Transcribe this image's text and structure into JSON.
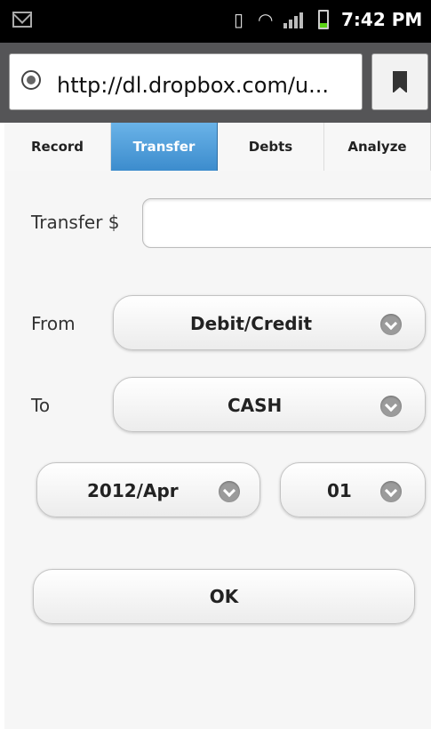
{
  "status_bar": {
    "time": "7:42 PM",
    "icons": [
      "mail-icon",
      "vibrate-icon",
      "wifi-icon",
      "signal-icon",
      "battery-icon"
    ]
  },
  "browser": {
    "url": "http://dl.dropbox.com/u..."
  },
  "tabs": [
    {
      "label": "Record"
    },
    {
      "label": "Transfer"
    },
    {
      "label": "Debts"
    },
    {
      "label": "Analyze"
    }
  ],
  "form": {
    "amount_label": "Transfer $",
    "amount_value": "",
    "from_label": "From",
    "from_value": "Debit/Credit",
    "to_label": "To",
    "to_value": "CASH",
    "month_value": "2012/Apr",
    "day_value": "01",
    "ok_label": "OK"
  },
  "colors": {
    "active_tab": "#4a9bda",
    "status_bar": "#000000"
  }
}
